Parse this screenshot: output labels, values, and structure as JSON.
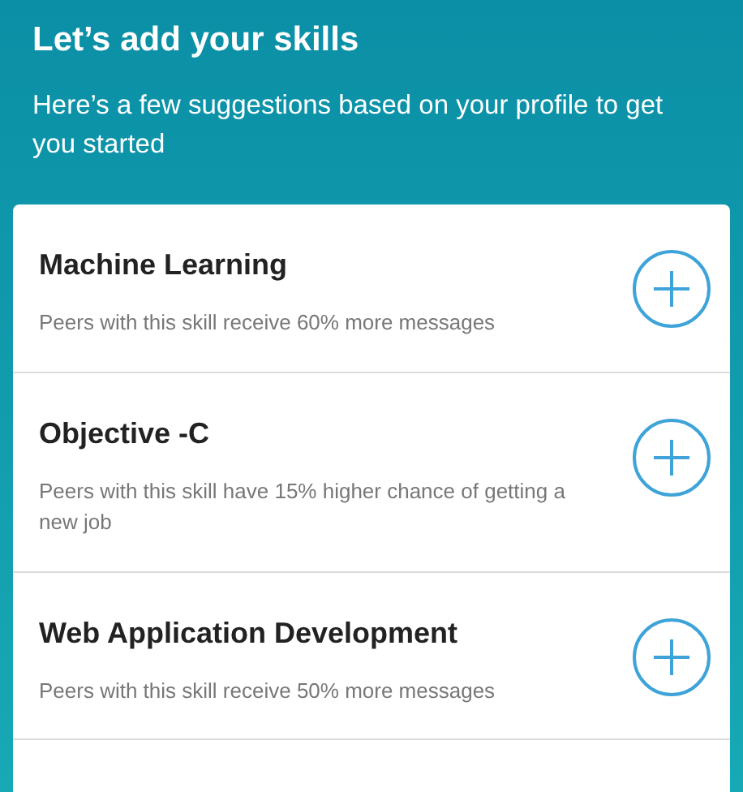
{
  "header": {
    "title": "Let’s add your skills",
    "subtitle": "Here’s a few suggestions based on your profile to get you started"
  },
  "skills": [
    {
      "name": "Machine Learning",
      "description": "Peers with this skill receive 60% more messages"
    },
    {
      "name": "Objective -C",
      "description": "Peers with this skill have 15% higher chance of getting a new job"
    },
    {
      "name": "Web Application Development",
      "description": "Peers with this skill receive 50% more messages"
    }
  ]
}
